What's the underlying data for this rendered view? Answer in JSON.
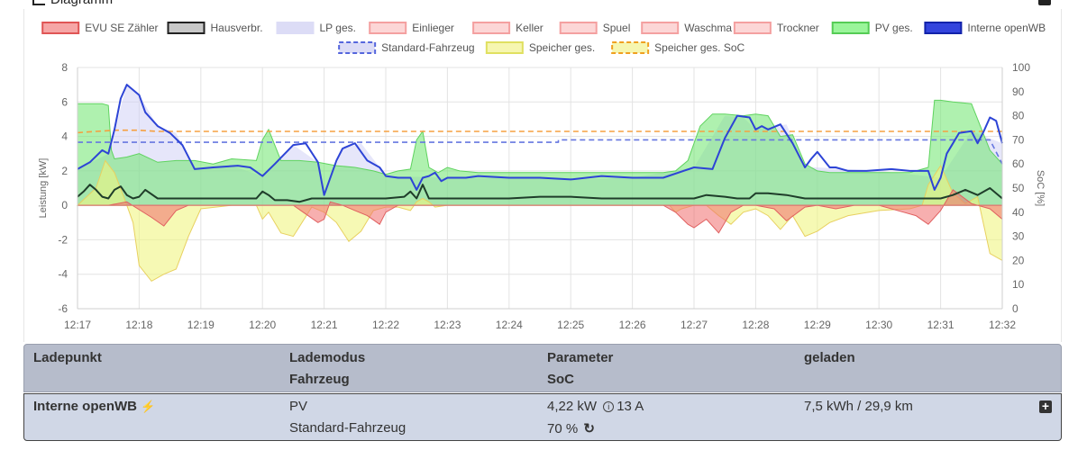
{
  "card": {
    "title": "Diagramm"
  },
  "chart_data": {
    "type": "area",
    "y_left": {
      "label": "Leistung [kW]",
      "min": -6,
      "max": 8,
      "ticks": [
        8,
        6,
        4,
        2,
        0,
        -2,
        -4,
        -6
      ]
    },
    "y_right": {
      "label": "SoC [%]",
      "min": 0,
      "max": 100,
      "ticks": [
        100,
        90,
        80,
        70,
        60,
        50,
        40,
        30,
        20,
        10,
        0
      ]
    },
    "x_ticks": [
      "12:17",
      "12:18",
      "12:19",
      "12:20",
      "12:21",
      "12:22",
      "12:23",
      "12:24",
      "12:25",
      "12:26",
      "12:27",
      "12:28",
      "12:29",
      "12:30",
      "12:31",
      "12:32"
    ],
    "x_range": [
      0,
      15
    ],
    "legend_position": "top",
    "legend": [
      {
        "name": "EVU SE Zähler",
        "fill": "#f6a6a6",
        "stroke": "#e05555",
        "dash": false
      },
      {
        "name": "Hausverbr.",
        "fill": "#c8c8c8",
        "stroke": "#222222",
        "dash": false
      },
      {
        "name": "LP ges.",
        "fill": "#dcdcf6",
        "stroke": "#dcdcf6",
        "dash": false
      },
      {
        "name": "Einlieger",
        "fill": "#fcd6d6",
        "stroke": "#f4a0a0",
        "dash": false
      },
      {
        "name": "Keller",
        "fill": "#fcd6d6",
        "stroke": "#f4a0a0",
        "dash": false
      },
      {
        "name": "Spuel",
        "fill": "#fcd6d6",
        "stroke": "#f4a0a0",
        "dash": false
      },
      {
        "name": "Waschma",
        "fill": "#fcd6d6",
        "stroke": "#f4a0a0",
        "dash": false
      },
      {
        "name": "Trockner",
        "fill": "#fcd6d6",
        "stroke": "#f4a0a0",
        "dash": false
      },
      {
        "name": "PV ges.",
        "fill": "#9af59a",
        "stroke": "#55cc55",
        "dash": false
      },
      {
        "name": "Interne openWB",
        "fill": "#3344dd",
        "stroke": "#1122aa",
        "dash": false
      },
      {
        "name": "Standard-Fahrzeug",
        "fill": "#dcdcf6",
        "stroke": "#5566dd",
        "dash": true
      },
      {
        "name": "Speicher ges.",
        "fill": "#f6f6b0",
        "stroke": "#e0e060",
        "dash": false
      },
      {
        "name": "Speicher ges. SoC",
        "fill": "#f6f6b0",
        "stroke": "#f0a020",
        "dash": true
      }
    ],
    "series": [
      {
        "name": "PV ges.",
        "axis": "left",
        "kind": "area",
        "x": [
          0,
          0.4,
          0.5,
          0.55,
          0.6,
          0.8,
          1.0,
          1.3,
          1.6,
          1.9,
          2.2,
          2.5,
          2.9,
          3.0,
          3.1,
          3.3,
          3.6,
          3.9,
          4.2,
          4.5,
          4.8,
          5.0,
          5.2,
          5.4,
          5.5,
          5.6,
          5.7,
          5.85,
          6.0,
          6.2,
          6.5,
          7.0,
          7.5,
          8.0,
          8.5,
          9.0,
          9.5,
          9.7,
          9.9,
          10.0,
          10.1,
          10.3,
          10.5,
          10.8,
          11.0,
          11.2,
          11.4,
          11.6,
          11.8,
          12.0,
          12.2,
          12.5,
          13.0,
          13.5,
          13.8,
          13.9,
          14.0,
          14.2,
          14.5,
          14.8,
          15.0
        ],
        "y": [
          5.9,
          5.9,
          5.8,
          3.2,
          2.7,
          2.8,
          3.0,
          2.5,
          2.6,
          2.6,
          2.4,
          2.7,
          2.6,
          3.8,
          4.4,
          2.6,
          2.6,
          2.5,
          2.3,
          2.2,
          2.0,
          1.8,
          2.0,
          2.1,
          3.8,
          4.3,
          2.2,
          1.9,
          2.2,
          2.0,
          1.9,
          1.9,
          1.9,
          1.9,
          1.9,
          1.9,
          1.9,
          2.0,
          2.6,
          3.6,
          4.6,
          5.3,
          5.3,
          5.2,
          5.3,
          5.2,
          4.0,
          4.1,
          2.4,
          2.0,
          1.9,
          1.9,
          1.9,
          1.9,
          2.2,
          6.1,
          6.1,
          6.0,
          5.9,
          3.2,
          2.4
        ]
      },
      {
        "name": "Speicher ges.",
        "axis": "left",
        "kind": "area",
        "x": [
          0,
          0.3,
          0.45,
          0.6,
          0.75,
          0.9,
          1.0,
          1.2,
          1.4,
          1.6,
          1.8,
          2.0,
          2.5,
          2.9,
          3.0,
          3.1,
          3.3,
          3.5,
          3.8,
          4.0,
          4.2,
          4.4,
          4.6,
          4.8,
          5.0,
          5.2,
          5.4,
          5.5,
          5.6,
          5.7,
          5.8,
          6.0,
          6.5,
          7.0,
          8.0,
          9.0,
          9.6,
          9.7,
          9.8,
          10.0,
          10.2,
          10.4,
          10.6,
          10.8,
          11.0,
          11.2,
          11.4,
          11.6,
          11.8,
          12.0,
          12.2,
          12.5,
          13.0,
          13.5,
          13.7,
          13.8,
          14.0,
          14.2,
          14.4,
          14.6,
          14.8,
          15.0
        ],
        "y": [
          0,
          1.0,
          2.6,
          1.9,
          0.5,
          -1.0,
          -3.5,
          -4.4,
          -4.0,
          -3.7,
          -1.8,
          -0.2,
          0,
          0,
          -0.8,
          -0.4,
          -1.6,
          -1.8,
          -0.1,
          -0.4,
          -1.0,
          -2.1,
          -1.5,
          -0.3,
          -0.1,
          -0.1,
          -0.3,
          0.2,
          0.4,
          0.2,
          -0.1,
          0,
          0,
          0,
          0,
          0,
          0,
          -0.4,
          -0.2,
          0,
          0,
          -0.6,
          -1.1,
          -0.4,
          -0.2,
          -0.6,
          -1.4,
          -0.6,
          -1.8,
          -1.5,
          -1.0,
          -0.6,
          -0.3,
          -0.2,
          0,
          1.2,
          2.3,
          0.7,
          0.1,
          0.5,
          -2.8,
          -3.2
        ]
      },
      {
        "name": "Interne openWB",
        "axis": "left",
        "kind": "line",
        "x": [
          0,
          0.2,
          0.4,
          0.5,
          0.6,
          0.7,
          0.8,
          1.0,
          1.1,
          1.3,
          1.5,
          1.7,
          1.9,
          2.2,
          2.6,
          2.8,
          3.0,
          3.2,
          3.5,
          3.7,
          3.9,
          4.0,
          4.2,
          4.3,
          4.5,
          4.7,
          4.9,
          5.0,
          5.2,
          5.4,
          5.5,
          5.6,
          5.7,
          5.8,
          5.9,
          6.0,
          6.3,
          6.5,
          7.0,
          7.5,
          8.0,
          8.5,
          9.0,
          9.5,
          10.0,
          10.3,
          10.5,
          10.7,
          10.9,
          11.0,
          11.1,
          11.2,
          11.4,
          11.6,
          11.8,
          11.9,
          12.0,
          12.2,
          12.3,
          12.5,
          12.8,
          13.2,
          13.5,
          13.8,
          13.9,
          14.0,
          14.1,
          14.2,
          14.3,
          14.5,
          14.6,
          14.7,
          14.8,
          14.9,
          15.0
        ],
        "y": [
          2.1,
          2.5,
          3.2,
          3.0,
          4.4,
          6.2,
          7.0,
          6.4,
          5.4,
          4.6,
          4.2,
          3.5,
          2.1,
          2.2,
          2.3,
          2.2,
          1.7,
          2.4,
          3.5,
          3.6,
          2.5,
          0.6,
          2.6,
          3.3,
          3.6,
          2.6,
          2.2,
          1.7,
          1.6,
          1.6,
          0.9,
          1.6,
          1.7,
          1.9,
          1.4,
          1.6,
          1.6,
          1.7,
          1.6,
          1.6,
          1.5,
          1.7,
          1.6,
          1.6,
          2.2,
          2.1,
          3.9,
          5.2,
          5.1,
          4.4,
          4.6,
          4.4,
          4.7,
          3.6,
          2.2,
          2.7,
          3.1,
          2.2,
          2.2,
          2.0,
          2.0,
          2.1,
          2.0,
          2.0,
          0.9,
          1.6,
          3.0,
          3.6,
          4.2,
          4.3,
          3.6,
          4.3,
          5.1,
          4.9,
          3.6
        ]
      },
      {
        "name": "Hausverbr.",
        "axis": "left",
        "kind": "line",
        "x": [
          0,
          0.1,
          0.2,
          0.3,
          0.4,
          0.5,
          0.6,
          0.7,
          0.8,
          0.9,
          1.0,
          1.1,
          1.3,
          1.6,
          2.0,
          2.5,
          2.9,
          3.0,
          3.1,
          3.2,
          3.4,
          3.6,
          3.8,
          4.0,
          4.2,
          4.5,
          5.0,
          5.3,
          5.4,
          5.5,
          5.6,
          5.7,
          5.8,
          6.0,
          6.5,
          7.0,
          7.5,
          8.0,
          8.5,
          9.0,
          9.5,
          10.0,
          10.2,
          10.5,
          10.7,
          10.9,
          11.0,
          11.2,
          11.5,
          11.8,
          12.0,
          12.5,
          13.0,
          13.5,
          13.8,
          14.0,
          14.2,
          14.4,
          14.6,
          14.8,
          15.0
        ],
        "y": [
          0.5,
          0.8,
          1.2,
          0.9,
          0.5,
          0.4,
          0.9,
          1.1,
          0.6,
          0.4,
          0.5,
          0.9,
          0.4,
          0.4,
          0.4,
          0.4,
          0.4,
          0.8,
          0.6,
          0.3,
          0.3,
          0.2,
          0.4,
          0.4,
          0.4,
          0.4,
          0.4,
          0.5,
          0.8,
          0.4,
          1.2,
          0.4,
          0.4,
          0.4,
          0.4,
          0.4,
          0.5,
          0.5,
          0.4,
          0.4,
          0.4,
          0.4,
          0.6,
          0.5,
          0.4,
          0.4,
          0.7,
          0.7,
          0.6,
          0.4,
          0.4,
          0.4,
          0.4,
          0.4,
          0.4,
          0.4,
          0.6,
          0.9,
          0.6,
          1.0,
          0.4
        ]
      },
      {
        "name": "EVU SE Zähler",
        "axis": "left",
        "kind": "area",
        "x": [
          0,
          0.5,
          0.8,
          1.2,
          1.4,
          1.6,
          1.8,
          2.0,
          2.5,
          3.0,
          3.5,
          3.7,
          3.9,
          4.0,
          4.1,
          4.3,
          4.5,
          4.7,
          4.9,
          5.0,
          5.2,
          5.5,
          6.0,
          7.0,
          8.0,
          9.0,
          9.5,
          9.7,
          9.9,
          10.0,
          10.2,
          10.4,
          10.6,
          10.8,
          11.0,
          11.3,
          11.5,
          11.8,
          12.0,
          12.3,
          12.6,
          13.0,
          13.4,
          13.6,
          13.8,
          14.0,
          14.2,
          14.5,
          14.8,
          15.0
        ],
        "y": [
          0,
          0,
          0.2,
          -0.7,
          -1.2,
          -0.3,
          0,
          0,
          0,
          0,
          0,
          -0.5,
          -1.0,
          -0.8,
          0.2,
          0,
          -0.3,
          -0.6,
          -1.1,
          -0.4,
          0,
          0,
          0,
          0,
          0,
          0,
          0,
          -0.4,
          -1.1,
          -1.3,
          -0.8,
          -1.6,
          -0.4,
          0,
          0,
          -0.2,
          -0.9,
          -0.1,
          0,
          -0.2,
          0,
          0,
          -0.4,
          -0.6,
          -1.1,
          -0.3,
          0.9,
          0.1,
          -0.2,
          -0.8
        ]
      },
      {
        "name": "LP ges.",
        "axis": "left",
        "kind": "area",
        "x": [
          0,
          0.5,
          0.8,
          1.0,
          1.3,
          1.6,
          1.9,
          2.2,
          2.5,
          3.0,
          3.5,
          3.9,
          4.0,
          4.3,
          4.6,
          4.9,
          5.0,
          6.0,
          7.0,
          8.0,
          9.0,
          10.0,
          10.5,
          10.8,
          11.0,
          11.5,
          11.8,
          12.0,
          13.0,
          14.0,
          14.5,
          15.0
        ],
        "y": [
          2.1,
          3.0,
          7.0,
          6.4,
          4.6,
          4.2,
          2.1,
          2.2,
          2.3,
          1.7,
          3.5,
          2.5,
          0.6,
          3.3,
          3.6,
          2.2,
          1.7,
          1.6,
          1.6,
          1.5,
          1.6,
          2.2,
          5.2,
          5.1,
          4.4,
          4.7,
          2.2,
          2.2,
          2.0,
          1.6,
          4.3,
          3.6
        ]
      },
      {
        "name": "Speicher ges. SoC",
        "axis": "right",
        "kind": "line",
        "x": [
          0,
          0.3,
          0.6,
          1.0,
          1.3,
          2.0,
          15.0
        ],
        "y": [
          73,
          73.5,
          74,
          74,
          73.5,
          73.5,
          73.5
        ]
      },
      {
        "name": "Standard-Fahrzeug",
        "axis": "right",
        "kind": "line",
        "x": [
          0,
          7.8,
          7.8,
          14.8,
          15.0
        ],
        "y": [
          69,
          69,
          70,
          70,
          60
        ]
      }
    ]
  },
  "table": {
    "headers": {
      "ladepunkt": "Ladepunkt",
      "lademodus": "Lademodus",
      "fahrzeug": "Fahrzeug",
      "parameter": "Parameter",
      "soc": "SoC",
      "geladen": "geladen"
    },
    "rows": [
      {
        "ladepunkt": "Interne openWB",
        "lademodus": "PV",
        "fahrzeug": "Standard-Fahrzeug",
        "leistung": "4,22 kW",
        "strom": "13 A",
        "soc": "70 %",
        "geladen": "7,5 kWh / 29,9 km"
      }
    ]
  }
}
